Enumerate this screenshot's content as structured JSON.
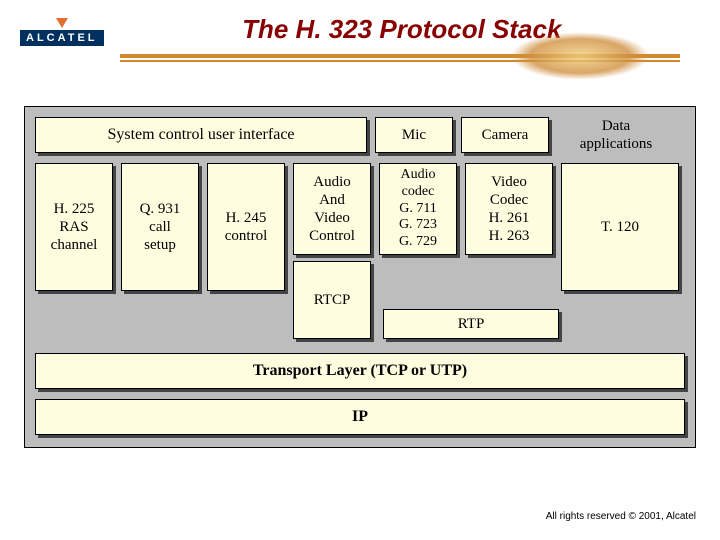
{
  "logo": "ALCATEL",
  "title": "The H. 323 Protocol  Stack",
  "top": {
    "sys_control": "System control user interface",
    "mic": "Mic",
    "camera": "Camera",
    "data_apps": "Data\napplications"
  },
  "mid": {
    "h225": "H. 225\nRAS\nchannel",
    "q931": "Q. 931\ncall\nsetup",
    "h245": "H. 245\ncontrol",
    "av_control": "Audio\nAnd\nVideo\nControl",
    "rtcp": "RTCP",
    "audio_codec": "Audio\ncodec\nG. 711\nG. 723\nG. 729",
    "video_codec": "Video\nCodec\nH. 261\nH. 263",
    "t120": "T. 120",
    "rtp": "RTP"
  },
  "transport": "Transport Layer (TCP or UTP)",
  "ip": "IP",
  "footer": "All rights reserved © 2001, Alcatel"
}
